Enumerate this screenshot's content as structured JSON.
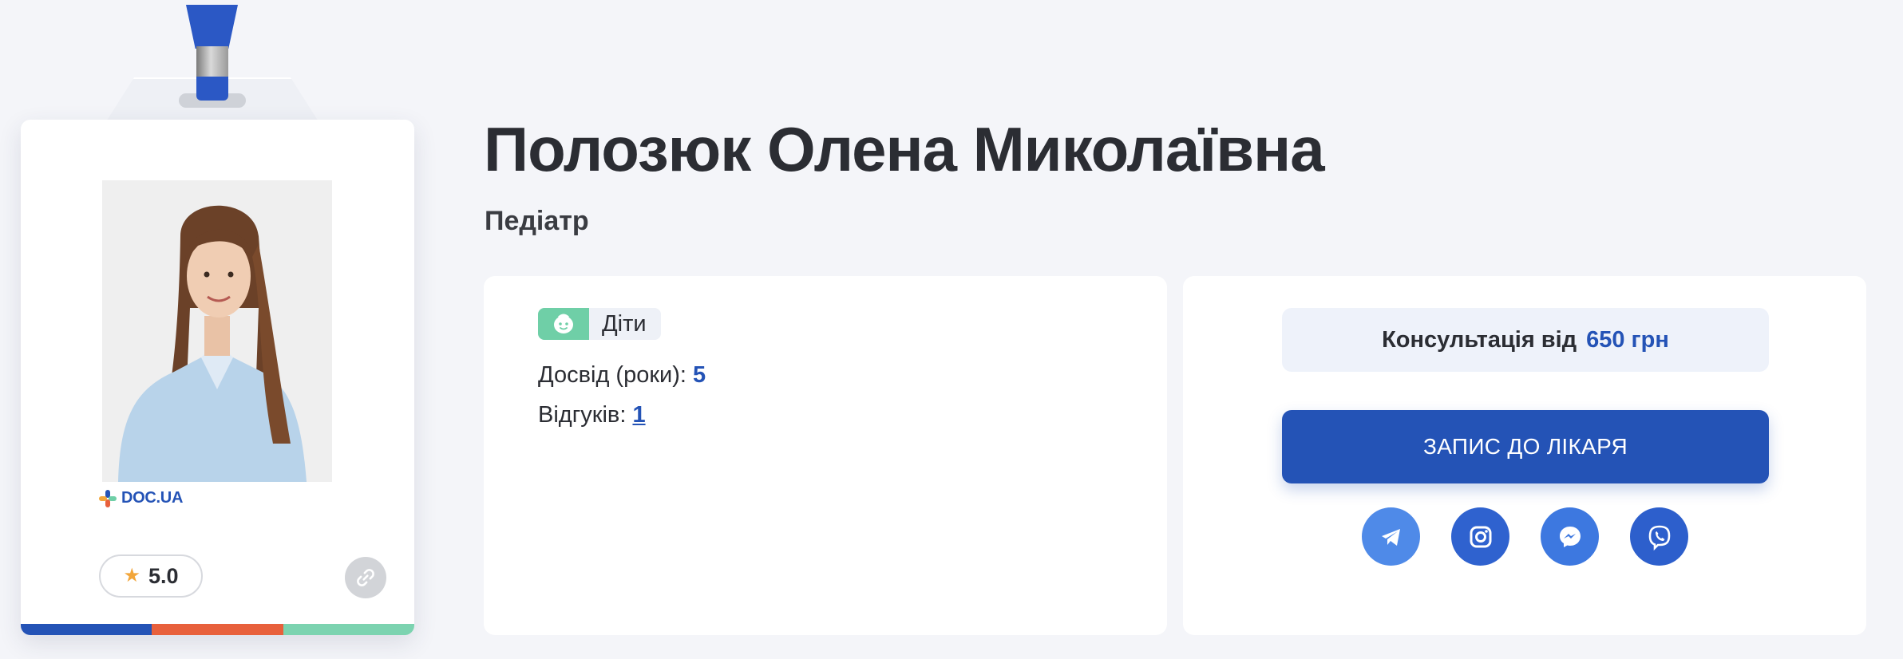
{
  "doctor": {
    "name": "Полозюк Олена Миколаївна",
    "specialty": "Педіатр"
  },
  "badge": {
    "brand": "DOC.UA",
    "rating": "5.0",
    "stripe_colors": [
      "#2453b6",
      "#e8603c",
      "#7cd3b0"
    ]
  },
  "info": {
    "tag_label": "Діти",
    "experience_label": "Досвід (роки):",
    "experience_value": "5",
    "reviews_label": "Відгуків:",
    "reviews_value": "1"
  },
  "booking": {
    "price_prefix": "Консультація від",
    "price_value": "650 грн",
    "book_button_label": "ЗАПИС ДО ЛІКАРЯ"
  },
  "socials": [
    {
      "icon": "telegram-icon"
    },
    {
      "icon": "instagram-icon"
    },
    {
      "icon": "messenger-icon"
    },
    {
      "icon": "viber-icon"
    }
  ],
  "colors": {
    "accent": "#2453b6",
    "kids_tag": "#6fcfa7",
    "star": "#f2a63b",
    "background": "#f4f5f9"
  }
}
